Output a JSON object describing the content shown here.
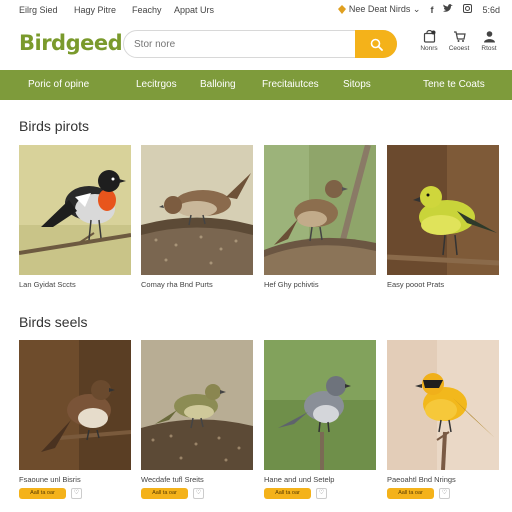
{
  "topbar": {
    "links": [
      "Eilrg Sied",
      "Hagy Pitre",
      "Feachy",
      "Appat Urs"
    ],
    "promo": "Nee Deat Nirds",
    "count": "5:6d"
  },
  "header": {
    "logo": "Birdgeed",
    "search_placeholder": "Stor nore",
    "icons": [
      {
        "icon": "bag-icon",
        "label": "Nonrs"
      },
      {
        "icon": "cart-icon",
        "label": "Ceoest"
      },
      {
        "icon": "user-icon",
        "label": "Rtost"
      }
    ]
  },
  "nav": {
    "items": [
      "Poric of opine",
      "Lecitrgos",
      "Balloing",
      "Frecitaiutces",
      "Sitops",
      "Tene te Coats"
    ]
  },
  "sections": [
    {
      "title": "Birds pirots",
      "products": [
        {
          "name": "Lan Gyidat Sccts",
          "photo": "robin-photo"
        },
        {
          "name": "Comay rha Bnd Purts",
          "photo": "sparrow-photo"
        },
        {
          "name": "Hef Ghy pchivtis",
          "photo": "finch-photo"
        },
        {
          "name": "Easy pooot Prats",
          "photo": "goldfinch-photo"
        }
      ]
    },
    {
      "title": "Birds seels",
      "products": [
        {
          "name": "Fsaoune unl Bisris",
          "photo": "sparrow-photo",
          "add": "Aall ta oar",
          "fav": "♡"
        },
        {
          "name": "Wecdafe tufl Sreits",
          "photo": "warbler-photo",
          "add": "Aall ta oar",
          "fav": "♡"
        },
        {
          "name": "Hane and und Setelp",
          "photo": "junco-photo",
          "add": "Aall ta oar",
          "fav": "♡"
        },
        {
          "name": "Paeoahtl Bnd Nrings",
          "photo": "oriole-photo",
          "add": "Aall ta oar",
          "fav": "♡"
        }
      ]
    }
  ]
}
